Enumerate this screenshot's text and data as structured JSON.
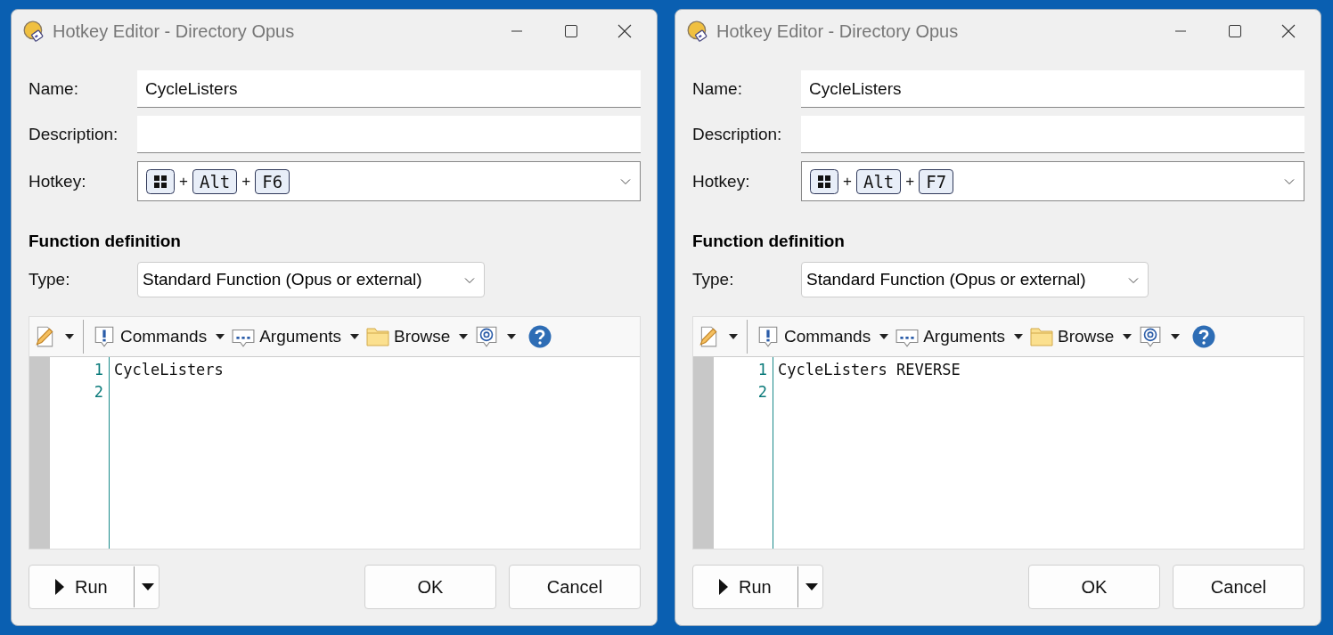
{
  "windows": [
    {
      "title": "Hotkey Editor - Directory Opus",
      "fields": [
        {
          "label": "Name:",
          "value": "CycleListers"
        },
        {
          "label": "Description:"
        }
      ],
      "hotkey": {
        "label": "Hotkey:",
        "keys": [
          {
            "kind": "win"
          },
          {
            "kind": "plus",
            "label": "+"
          },
          {
            "kind": "key",
            "label": "Alt"
          },
          {
            "kind": "plus",
            "label": "+"
          },
          {
            "kind": "key",
            "label": "F6"
          }
        ]
      },
      "section": "Function definition",
      "type": {
        "label": "Type:",
        "value": "Standard Function (Opus or external)"
      },
      "toolbar": [
        {
          "kind": "edit"
        },
        {
          "kind": "commands",
          "label": "Commands"
        },
        {
          "kind": "arguments",
          "label": "Arguments"
        },
        {
          "kind": "browse",
          "label": "Browse"
        },
        {
          "kind": "at"
        },
        {
          "kind": "help"
        }
      ],
      "lines": [
        {
          "number": "1",
          "text": "CycleListers"
        },
        {
          "number": "2"
        }
      ],
      "buttons": [
        {
          "kind": "run",
          "label": "Run"
        },
        {
          "kind": "ok",
          "label": "OK"
        },
        {
          "kind": "cancel",
          "label": "Cancel"
        }
      ]
    },
    {
      "title": "Hotkey Editor - Directory Opus",
      "fields": [
        {
          "label": "Name:",
          "value": "CycleListers"
        },
        {
          "label": "Description:"
        }
      ],
      "hotkey": {
        "label": "Hotkey:",
        "keys": [
          {
            "kind": "win"
          },
          {
            "kind": "plus",
            "label": "+"
          },
          {
            "kind": "key",
            "label": "Alt"
          },
          {
            "kind": "plus",
            "label": "+"
          },
          {
            "kind": "key",
            "label": "F7"
          }
        ]
      },
      "section": "Function definition",
      "type": {
        "label": "Type:",
        "value": "Standard Function (Opus or external)"
      },
      "toolbar": [
        {
          "kind": "edit"
        },
        {
          "kind": "commands",
          "label": "Commands"
        },
        {
          "kind": "arguments",
          "label": "Arguments"
        },
        {
          "kind": "browse",
          "label": "Browse"
        },
        {
          "kind": "at"
        },
        {
          "kind": "help"
        }
      ],
      "lines": [
        {
          "number": "1",
          "text": "CycleListers REVERSE"
        },
        {
          "number": "2"
        }
      ],
      "buttons": [
        {
          "kind": "run",
          "label": "Run"
        },
        {
          "kind": "ok",
          "label": "OK"
        },
        {
          "kind": "cancel",
          "label": "Cancel"
        }
      ]
    }
  ]
}
